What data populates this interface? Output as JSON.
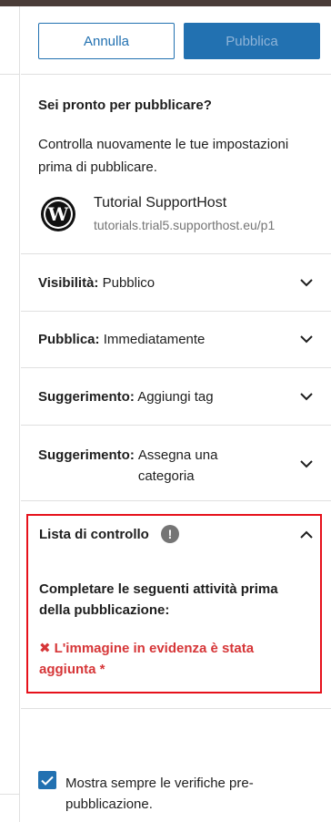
{
  "header": {
    "cancel_label": "Annulla",
    "publish_label": "Pubblica"
  },
  "prepublish": {
    "title": "Sei pronto per pubblicare?",
    "description": "Controlla nuovamente le tue impostazioni prima di pubblicare.",
    "site_name": "Tutorial SupportHost",
    "site_url": "tutorials.trial5.supporthost.eu/p1"
  },
  "panels": [
    {
      "label": "Visibilità:",
      "value": "Pubblico"
    },
    {
      "label": "Pubblica:",
      "value": "Immediatamente"
    },
    {
      "label": "Suggerimento:",
      "value": "Aggiungi tag"
    },
    {
      "label": "Suggerimento:",
      "value": "Assegna una categoria"
    }
  ],
  "checklist": {
    "title": "Lista di controllo",
    "info_glyph": "!",
    "description": "Completare le seguenti attività prima della pubblicazione:",
    "item_mark": "✖",
    "item_text": "L'immagine in evidenza è stata aggiunta *"
  },
  "footer": {
    "always_show_label": "Mostra sempre le verifiche pre-pubblicazione.",
    "always_show_checked": true
  },
  "colors": {
    "accent": "#2271b1",
    "error": "#d63638",
    "highlight_border": "#e6111b"
  }
}
